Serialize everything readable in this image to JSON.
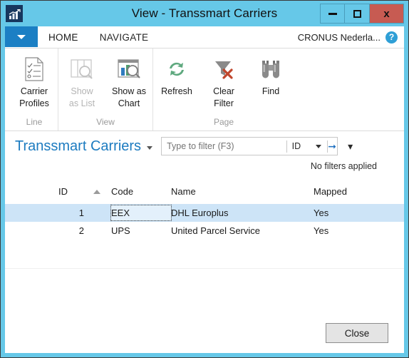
{
  "window": {
    "title": "View - Transsmart Carriers",
    "app_icon": "bar-chart-icon",
    "minimize_label": "",
    "maximize_label": "",
    "close_label": "x"
  },
  "tabs": {
    "app_menu_label": "",
    "items": [
      {
        "label": "HOME",
        "active": true
      },
      {
        "label": "NAVIGATE",
        "active": false
      }
    ],
    "company": "CRONUS Nederla...",
    "help_label": "?"
  },
  "ribbon": {
    "groups": [
      {
        "label": "Line",
        "buttons": [
          {
            "label_line1": "Carrier",
            "label_line2": "Profiles",
            "icon": "document-checklist-icon",
            "disabled": false
          }
        ]
      },
      {
        "label": "View",
        "buttons": [
          {
            "label_line1": "Show",
            "label_line2": "as List",
            "icon": "list-search-icon",
            "disabled": true
          },
          {
            "label_line1": "Show as",
            "label_line2": "Chart",
            "icon": "chart-search-icon",
            "disabled": false
          }
        ]
      },
      {
        "label": "Page",
        "buttons": [
          {
            "label_line1": "Refresh",
            "label_line2": "",
            "icon": "refresh-icon",
            "disabled": false
          },
          {
            "label_line1": "Clear",
            "label_line2": "Filter",
            "icon": "clear-filter-icon",
            "disabled": false
          },
          {
            "label_line1": "Find",
            "label_line2": "",
            "icon": "binoculars-icon",
            "disabled": false
          }
        ]
      }
    ]
  },
  "filter": {
    "page_title": "Transsmart Carriers",
    "input_value": "",
    "input_placeholder": "Type to filter (F3)",
    "field": "ID",
    "go_icon": "arrow-right-icon",
    "status": "No filters applied"
  },
  "grid": {
    "columns": [
      {
        "key": "id",
        "label": "ID",
        "sorted": "asc"
      },
      {
        "key": "code",
        "label": "Code"
      },
      {
        "key": "name",
        "label": "Name"
      },
      {
        "key": "mapped",
        "label": "Mapped"
      }
    ],
    "rows": [
      {
        "id": "1",
        "code": "EEX",
        "name": "DHL Europlus",
        "mapped": "Yes",
        "selected": true,
        "focused_cell": "code"
      },
      {
        "id": "2",
        "code": "UPS",
        "name": "United Parcel Service",
        "mapped": "Yes",
        "selected": false
      }
    ]
  },
  "footer": {
    "close_label": "Close"
  },
  "colors": {
    "window_frame": "#66c8e8",
    "accent_blue": "#1c7bc0",
    "selection": "#cde4f7",
    "close_red": "#c75b52",
    "app_menu_blue": "#1b7fc4"
  }
}
